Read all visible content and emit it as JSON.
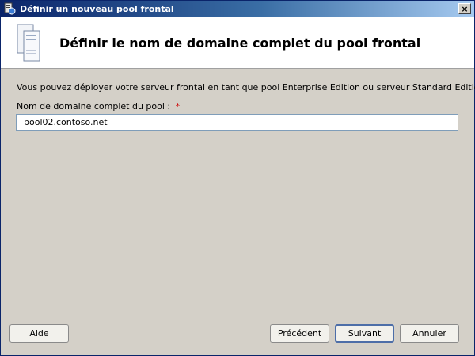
{
  "window": {
    "title": "Définir un nouveau pool frontal",
    "close_label": "×"
  },
  "header": {
    "title": "Définir le nom de domaine complet du pool frontal",
    "icon": "server-icon"
  },
  "main": {
    "description": "Vous pouvez déployer votre serveur frontal en tant que pool Enterprise Edition ou serveur Standard Edition.",
    "fqdn_label": "Nom de domaine complet du pool :",
    "required_marker": "*",
    "fqdn_value": "pool02.contoso.net"
  },
  "footer": {
    "help_label": "Aide",
    "previous_label": "Précédent",
    "next_label": "Suivant",
    "cancel_label": "Annuler"
  },
  "colors": {
    "titlebar_start": "#0a246a",
    "titlebar_end": "#a6caf0",
    "dialog_background": "#d4d0c8",
    "required_marker": "#cc0000"
  }
}
